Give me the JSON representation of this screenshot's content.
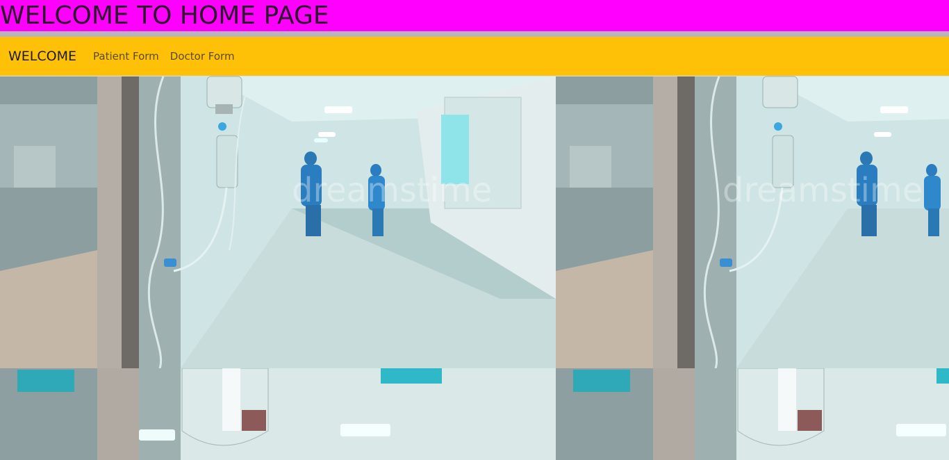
{
  "banner": {
    "title": "WELCOME TO HOME PAGE",
    "background": "#ff00ff"
  },
  "navbar": {
    "brand": "WELCOME",
    "background": "#ffc107",
    "links": [
      {
        "label": "Patient Form"
      },
      {
        "label": "Doctor Form"
      }
    ]
  },
  "background_image": {
    "subject": "hospital corridor with IV drip",
    "watermark": "dreamstime"
  }
}
